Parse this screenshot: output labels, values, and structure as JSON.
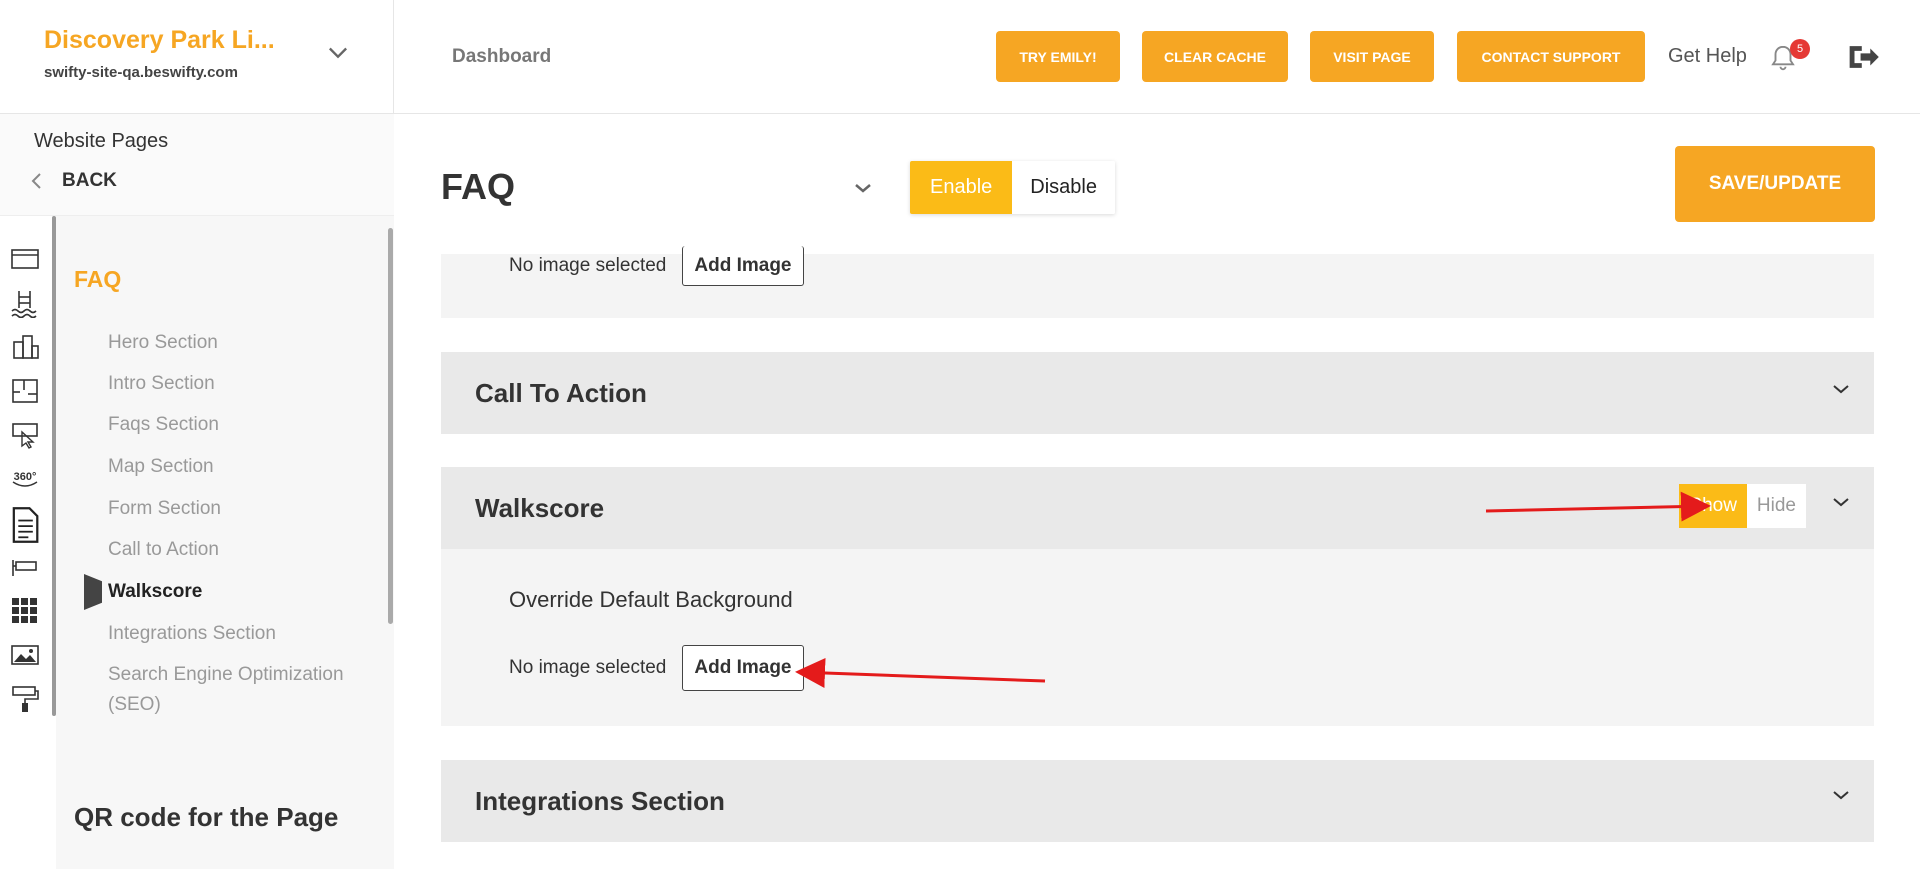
{
  "site": {
    "name": "Discovery Park Li...",
    "url": "swifty-site-qa.beswifty.com"
  },
  "header": {
    "breadcrumb": "Dashboard",
    "buttons": [
      "TRY EMILY!",
      "CLEAR CACHE",
      "VISIT PAGE",
      "CONTACT SUPPORT"
    ],
    "help": "Get Help",
    "notifications": "5"
  },
  "sidebar": {
    "title": "Website Pages",
    "back": "BACK",
    "page_title": "FAQ",
    "items": [
      {
        "label": "Hero Section"
      },
      {
        "label": "Intro Section"
      },
      {
        "label": "Faqs Section"
      },
      {
        "label": "Map Section"
      },
      {
        "label": "Form Section"
      },
      {
        "label": "Call to Action"
      },
      {
        "label": "Walkscore"
      },
      {
        "label": "Integrations Section"
      },
      {
        "label": "Search Engine Optimization"
      },
      {
        "label": "(SEO)"
      }
    ],
    "qr_title": "QR code for the Page",
    "rail_icons": [
      "browser-icon",
      "pool-icon",
      "buildings-icon",
      "floorplan-icon",
      "touch-icon",
      "360-icon",
      "document-icon",
      "sign-icon",
      "grid-icon",
      "image-icon",
      "paint-roller-icon"
    ]
  },
  "main": {
    "page_title": "FAQ",
    "toggle": {
      "enable": "Enable",
      "disable": "Disable"
    },
    "save": "SAVE/UPDATE",
    "prev_panel": {
      "no_image": "No image selected",
      "add_image": "Add Image"
    },
    "sections": [
      {
        "title": "Call To Action"
      },
      {
        "title": "Walkscore",
        "show": "Show",
        "hide": "Hide"
      },
      {
        "title": "Integrations Section"
      }
    ],
    "walkscore_body": {
      "override": "Override Default Background",
      "no_image": "No image selected",
      "add_image": "Add Image"
    }
  },
  "colors": {
    "accent": "#f6a623",
    "toggle_on": "#fbbb17",
    "annotation": "#e41b1b"
  }
}
